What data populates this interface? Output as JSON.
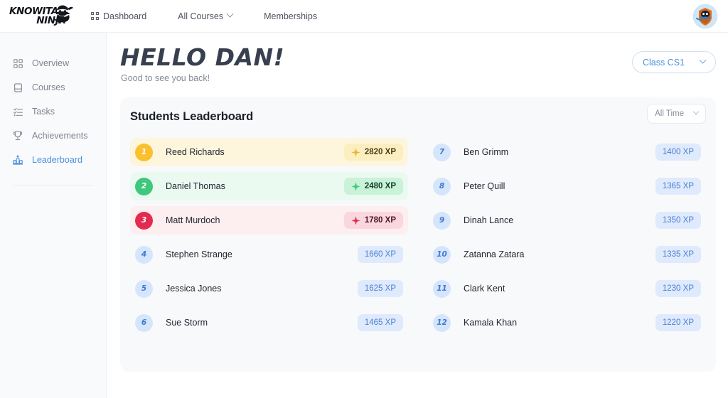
{
  "topnav": {
    "logo_line1": "KNOWITALL",
    "logo_line2": "NINJA",
    "logo_icon": "ninja-logo-icon",
    "links": [
      {
        "label": "Dashboard",
        "icon": "grid-icon",
        "has_chevron": false
      },
      {
        "label": "All Courses",
        "icon": "",
        "has_chevron": true
      },
      {
        "label": "Memberships",
        "icon": "",
        "has_chevron": false
      }
    ],
    "avatar_icon": "user-avatar"
  },
  "sidebar": {
    "items": [
      {
        "label": "Overview",
        "icon": "grid-icon",
        "active": false
      },
      {
        "label": "Courses",
        "icon": "book-icon",
        "active": false
      },
      {
        "label": "Tasks",
        "icon": "task-list-icon",
        "active": false
      },
      {
        "label": "Achievements",
        "icon": "trophy-icon",
        "active": false
      },
      {
        "label": "Leaderboard",
        "icon": "podium-icon",
        "active": true
      }
    ]
  },
  "header": {
    "greeting": "HELLO DAN!",
    "subtitle": "Good to see you back!",
    "class_selector": "Class CS1"
  },
  "leaderboard": {
    "title": "Students Leaderboard",
    "time_filter": "All Time",
    "xp_suffix": "XP",
    "left_column": [
      {
        "rank": "1",
        "name": "Reed Richards",
        "xp": "2820 XP",
        "style": "gold"
      },
      {
        "rank": "2",
        "name": "Daniel Thomas",
        "xp": "2480 XP",
        "style": "green"
      },
      {
        "rank": "3",
        "name": "Matt Murdoch",
        "xp": "1780 XP",
        "style": "red"
      },
      {
        "rank": "4",
        "name": "Stephen Strange",
        "xp": "1660 XP",
        "style": "plain"
      },
      {
        "rank": "5",
        "name": "Jessica Jones",
        "xp": "1625 XP",
        "style": "plain"
      },
      {
        "rank": "6",
        "name": "Sue Storm",
        "xp": "1465 XP",
        "style": "plain"
      }
    ],
    "right_column": [
      {
        "rank": "7",
        "name": "Ben Grimm",
        "xp": "1400 XP",
        "style": "plain"
      },
      {
        "rank": "8",
        "name": "Peter Quill",
        "xp": "1365 XP",
        "style": "plain"
      },
      {
        "rank": "9",
        "name": "Dinah Lance",
        "xp": "1350 XP",
        "style": "plain"
      },
      {
        "rank": "10",
        "name": "Zatanna Zatara",
        "xp": "1335 XP",
        "style": "plain"
      },
      {
        "rank": "11",
        "name": "Clark Kent",
        "xp": "1230 XP",
        "style": "plain"
      },
      {
        "rank": "12",
        "name": "Kamala Khan",
        "xp": "1220 XP",
        "style": "plain"
      }
    ]
  },
  "colors": {
    "accent_blue": "#4a90e2",
    "gold": "#fbc02d",
    "green": "#3ec77d",
    "red": "#e42a50",
    "plain_badge": "#d5e5fb",
    "card_bg": "#f8f9fb",
    "sidebar_bg": "#f9fafb"
  }
}
